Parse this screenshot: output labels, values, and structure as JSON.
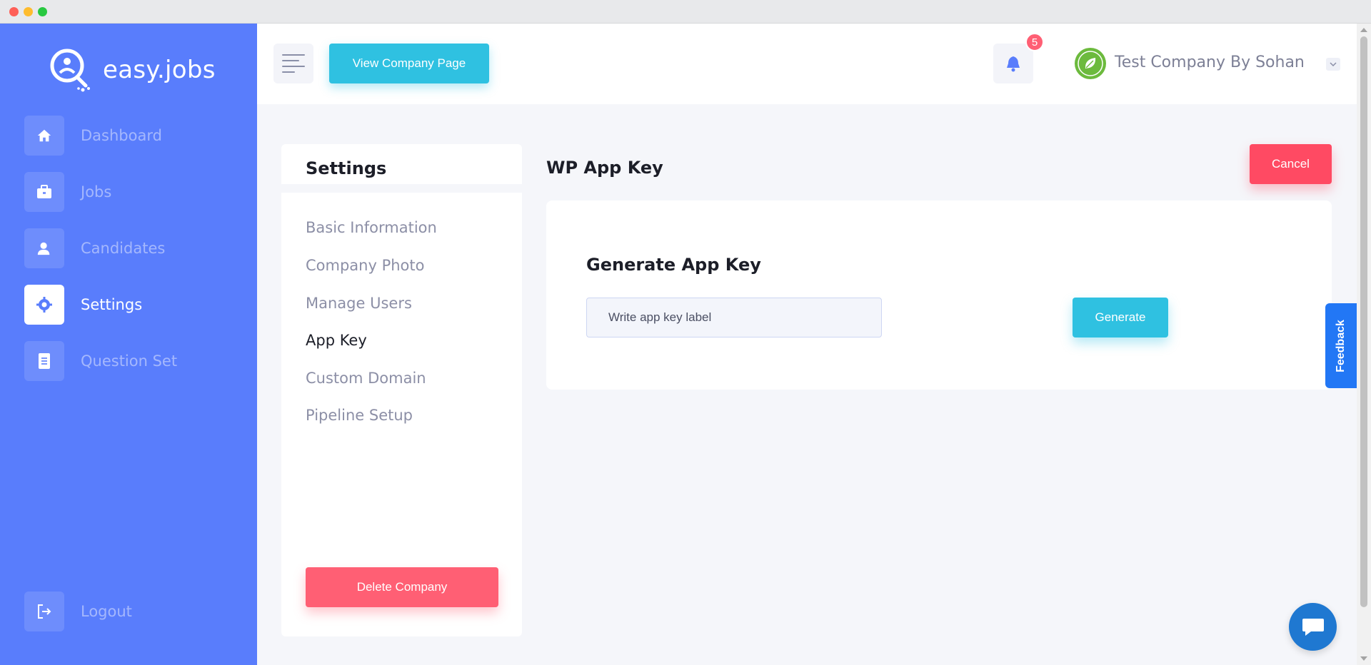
{
  "app": {
    "logo_text": "easy.jobs",
    "brand_color": "#597dfc",
    "accent_color": "#2fc1e1",
    "danger_color": "#ff5f74"
  },
  "sidebar": {
    "items": [
      {
        "label": "Dashboard",
        "icon": "home-icon",
        "active": false
      },
      {
        "label": "Jobs",
        "icon": "briefcase-icon",
        "active": false
      },
      {
        "label": "Candidates",
        "icon": "user-icon",
        "active": false
      },
      {
        "label": "Settings",
        "icon": "gear-icon",
        "active": true
      },
      {
        "label": "Question Set",
        "icon": "document-icon",
        "active": false
      }
    ],
    "logout_label": "Logout"
  },
  "header": {
    "view_company_label": "View Company Page",
    "notification_count": "5",
    "company_name": "Test Company By Sohan"
  },
  "settings": {
    "title": "Settings",
    "menu": [
      {
        "label": "Basic Information",
        "active": false
      },
      {
        "label": "Company Photo",
        "active": false
      },
      {
        "label": "Manage Users",
        "active": false
      },
      {
        "label": "App Key",
        "active": true
      },
      {
        "label": "Custom Domain",
        "active": false
      },
      {
        "label": "Pipeline Setup",
        "active": false
      }
    ],
    "delete_label": "Delete Company"
  },
  "content": {
    "page_title": "WP App Key",
    "cancel_label": "Cancel",
    "card_title": "Generate App Key",
    "input_placeholder": "Write app key label",
    "input_value": "",
    "generate_label": "Generate"
  },
  "widgets": {
    "feedback_label": "Feedback",
    "chat_icon": "chat-bubble-icon"
  }
}
